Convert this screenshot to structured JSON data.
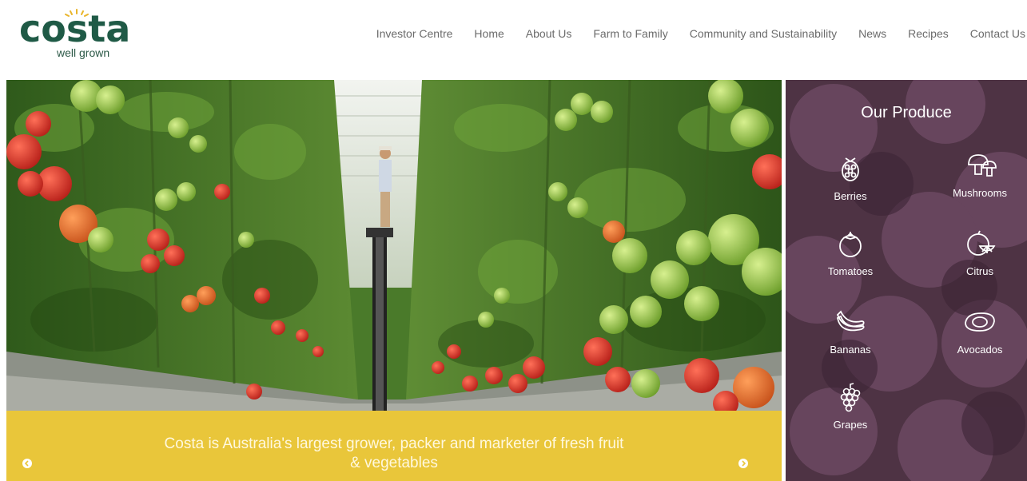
{
  "brand": {
    "name": "costa",
    "tagline": "well grown",
    "colors": {
      "brand_green": "#1f5a46",
      "accent_yellow": "#e9c63a",
      "panel_purple": "#5b3a4f"
    }
  },
  "nav": {
    "items": [
      "Investor Centre",
      "Home",
      "About Us",
      "Farm to Family",
      "Community and Sustainability",
      "News",
      "Recipes",
      "Contact Us"
    ]
  },
  "hero": {
    "caption_line1": "Costa is Australia's largest grower, packer and marketer of fresh fruit",
    "caption_line2": "& vegetables"
  },
  "produce": {
    "title": "Our Produce",
    "items": [
      {
        "label": "Berries",
        "icon": "berries-icon"
      },
      {
        "label": "Mushrooms",
        "icon": "mushroom-icon"
      },
      {
        "label": "Tomatoes",
        "icon": "tomato-icon"
      },
      {
        "label": "Citrus",
        "icon": "citrus-icon"
      },
      {
        "label": "Bananas",
        "icon": "banana-icon"
      },
      {
        "label": "Avocados",
        "icon": "avocado-icon"
      },
      {
        "label": "Grapes",
        "icon": "grapes-icon"
      }
    ]
  }
}
